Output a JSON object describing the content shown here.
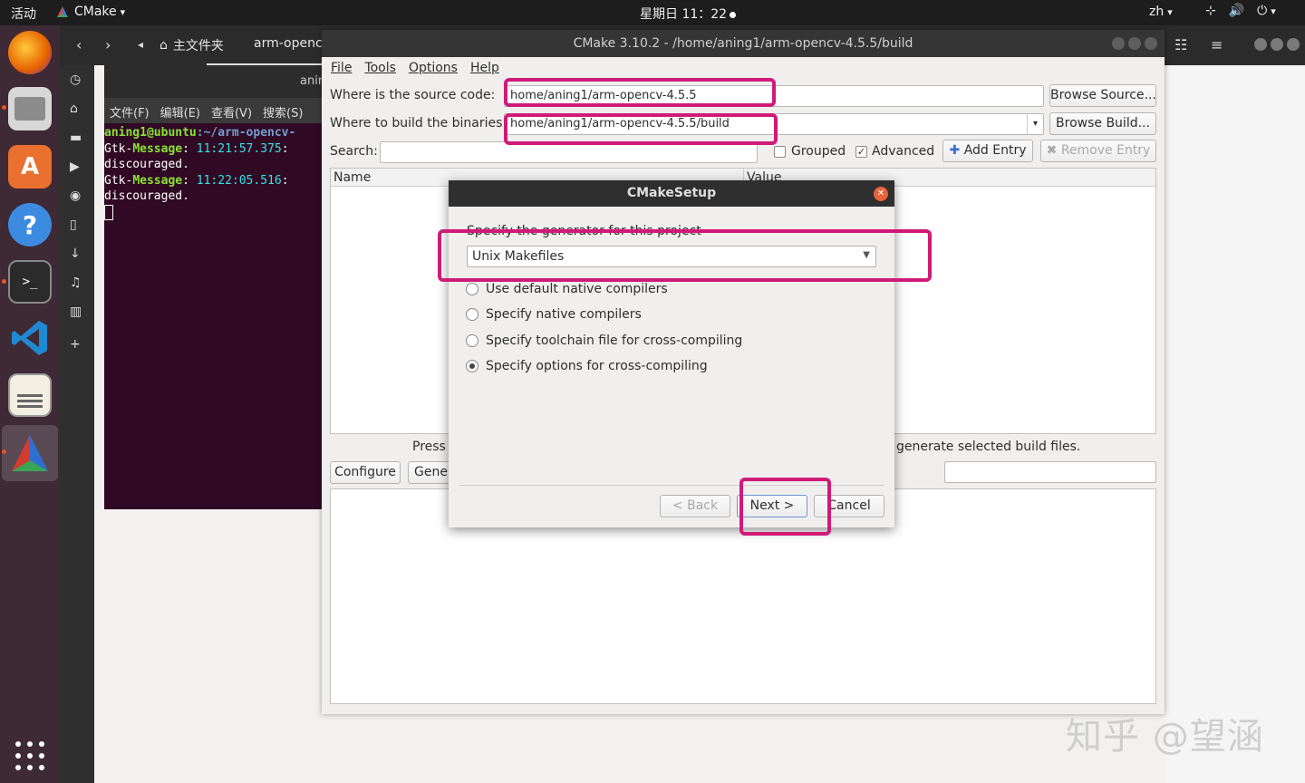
{
  "topbar": {
    "activities": "活动",
    "app_menu": "CMake",
    "clock": "星期日 11：22",
    "lang": "zh",
    "icons": [
      "network-icon",
      "volume-icon",
      "power-icon"
    ]
  },
  "dock": {
    "apps": [
      "firefox-icon",
      "files-icon",
      "software-icon",
      "help-icon",
      "terminal-icon",
      "vscode-icon",
      "text-editor-icon",
      "cmake-icon"
    ],
    "show_apps": "show-apps-icon"
  },
  "file_manager": {
    "home_label": "主文件夹",
    "path_label": "arm-opencv"
  },
  "terminal": {
    "title": "anin",
    "menu": [
      "文件(F)",
      "编辑(E)",
      "查看(V)",
      "搜索(S)"
    ],
    "prompt_user": "aning1@ubuntu",
    "prompt_path": ":~/arm-opencv-",
    "lines": [
      {
        "label": "Gtk-",
        "msg": "Message",
        "time": "11:21:57.375",
        "rest": ":"
      },
      {
        "text": "discouraged."
      },
      {
        "label": "Gtk-",
        "msg": "Message",
        "time": "11:22:05.516",
        "rest": ":"
      },
      {
        "text": "discouraged."
      }
    ]
  },
  "cmake": {
    "title": "CMake 3.10.2 - /home/aning1/arm-opencv-4.5.5/build",
    "menu": [
      "File",
      "Tools",
      "Options",
      "Help"
    ],
    "source_label": "Where is the source code:",
    "source_value": "home/aning1/arm-opencv-4.5.5",
    "build_label": "Where to build the binaries:",
    "build_value": "home/aning1/arm-opencv-4.5.5/build",
    "browse_source": "Browse Source...",
    "browse_build": "Browse Build...",
    "search_label": "Search:",
    "grouped_label": "Grouped",
    "grouped_checked": false,
    "advanced_label": "Advanced",
    "advanced_checked": true,
    "add_entry": "Add Entry",
    "remove_entry": "Remove Entry",
    "col_name": "Name",
    "col_value": "Value",
    "press_left": "Press",
    "press_right": "generate selected build files.",
    "configure": "Configure",
    "generate": "Gener"
  },
  "dialog": {
    "title": "CMakeSetup",
    "prompt": "Specify the generator for this project",
    "generator": "Unix Makefiles",
    "options": [
      {
        "label": "Use default native compilers",
        "selected": false
      },
      {
        "label": "Specify native compilers",
        "selected": false
      },
      {
        "label": "Specify toolchain file for cross-compiling",
        "selected": false
      },
      {
        "label": "Specify options for cross-compiling",
        "selected": true
      }
    ],
    "back": "< Back",
    "next": "Next >",
    "cancel": "Cancel"
  },
  "colors": {
    "highlight": "#d01a78",
    "terminal_bg": "#300a24",
    "dock_bg": "#3d2a35"
  },
  "watermark": "知乎 @望涵"
}
